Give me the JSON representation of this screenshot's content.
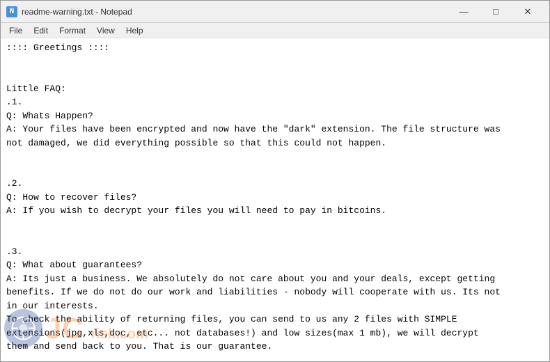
{
  "window": {
    "title": "readme-warning.txt - Notepad",
    "icon_label": "N"
  },
  "title_controls": {
    "minimize": "—",
    "maximize": "□",
    "close": "✕"
  },
  "menu": {
    "items": [
      "File",
      "Edit",
      "Format",
      "View",
      "Help"
    ]
  },
  "content": {
    "text": ":::: Greetings ::::\n\n\nLittle FAQ:\n.1.\nQ: Whats Happen?\nA: Your files have been encrypted and now have the \"dark\" extension. The file structure was\nnot damaged, we did everything possible so that this could not happen.\n\n\n.2.\nQ: How to recover files?\nA: If you wish to decrypt your files you will need to pay in bitcoins.\n\n\n.3.\nQ: What about guarantees?\nA: Its just a business. We absolutely do not care about you and your deals, except getting\nbenefits. If we do not do our work and liabilities - nobody will cooperate with us. Its not\nin our interests.\nTo check the ability of returning files, you can send to us any 2 files with SIMPLE\nextensions(jpg,xls,doc, etc... not databases!) and low sizes(max 1 mb), we will decrypt\nthem and send back to you. That is our guarantee.\n\n\n\nQ: How to contact with you?\nA: You can write us to our mailbox: revirsupport@privatemail.com"
  },
  "watermark": {
    "site": "risk.com",
    "display": "risk.com"
  }
}
